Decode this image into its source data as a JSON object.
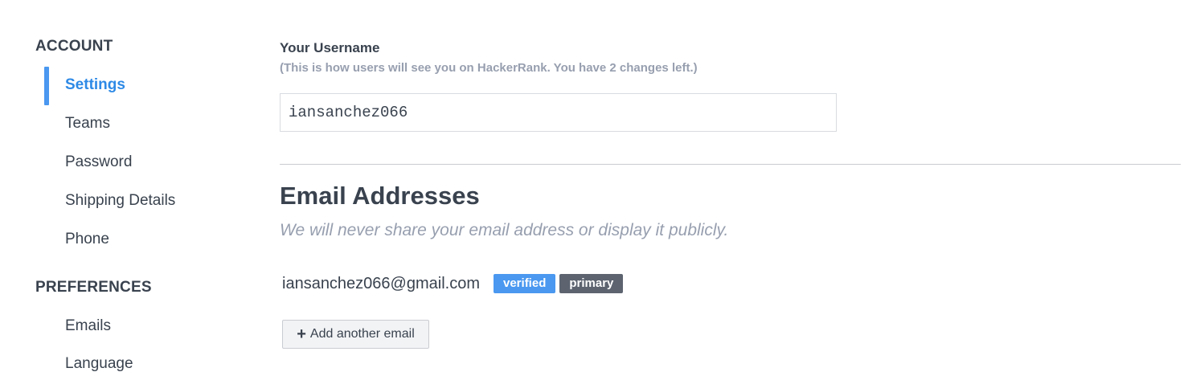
{
  "sidebar": {
    "account_title": "ACCOUNT",
    "account_items": [
      {
        "label": "Settings",
        "active": true
      },
      {
        "label": "Teams"
      },
      {
        "label": "Password"
      },
      {
        "label": "Shipping Details"
      },
      {
        "label": "Phone"
      }
    ],
    "preferences_title": "PREFERENCES",
    "preferences_items": [
      {
        "label": "Emails"
      },
      {
        "label": "Language"
      }
    ],
    "accent_color": "#4a98f0"
  },
  "username": {
    "label": "Your Username",
    "hint": "(This is how users will see you on HackerRank. You have 2 changes left.)",
    "value": "iansanchez066"
  },
  "email": {
    "title": "Email Addresses",
    "subtitle": "We will never share your email address or display it publicly.",
    "address": "iansanchez066@gmail.com",
    "badges": {
      "verified": "verified",
      "primary": "primary"
    },
    "add_button_label": "Add another email",
    "add_button_icon": "plus-icon",
    "add_button_glyph": "+"
  }
}
